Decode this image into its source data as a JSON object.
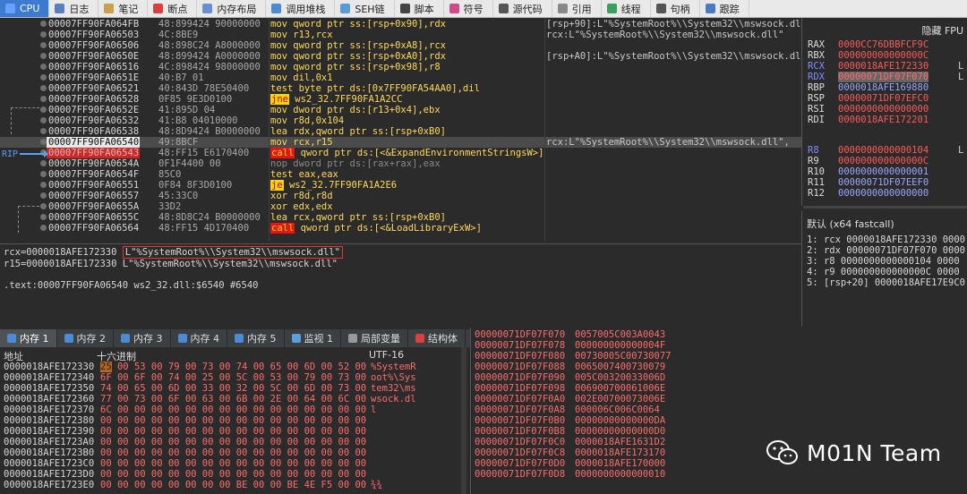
{
  "tabs": [
    {
      "label": "CPU",
      "icon": "cpu-icon",
      "color": "#6aa0ff",
      "active": true
    },
    {
      "label": "日志",
      "icon": "log-icon",
      "color": "#5a7fbf"
    },
    {
      "label": "笔记",
      "icon": "notes-icon",
      "color": "#c9a04b"
    },
    {
      "label": "断点",
      "icon": "breakpoint-icon",
      "color": "#d94040"
    },
    {
      "label": "内存布局",
      "icon": "memory-map-icon",
      "color": "#6a8fd0"
    },
    {
      "label": "调用堆栈",
      "icon": "call-stack-icon",
      "color": "#4b8bd6"
    },
    {
      "label": "SEH链",
      "icon": "seh-icon",
      "color": "#5a9bd8"
    },
    {
      "label": "脚本",
      "icon": "script-icon",
      "color": "#444"
    },
    {
      "label": "符号",
      "icon": "symbol-icon",
      "color": "#d04a8a"
    },
    {
      "label": "源代码",
      "icon": "source-icon",
      "color": "#555"
    },
    {
      "label": "引用",
      "icon": "reference-icon",
      "color": "#888"
    },
    {
      "label": "线程",
      "icon": "thread-icon",
      "color": "#3aa060"
    },
    {
      "label": "句柄",
      "icon": "handle-icon",
      "color": "#555"
    },
    {
      "label": "跟踪",
      "icon": "trace-icon",
      "color": "#4b7bc6"
    }
  ],
  "disasm": [
    {
      "addr": "00007FF90FA064FB",
      "bytes": "48:899424 90000000",
      "instr": "mov qword ptr ss:[rsp+0x90],rdx",
      "comment": "[rsp+90]:L\"%SystemRoot%\\\\System32\\\\mswsock.dll\""
    },
    {
      "addr": "00007FF90FA06503",
      "bytes": "4C:8BE9",
      "instr": "mov r13,rcx",
      "comment": "rcx:L\"%SystemRoot%\\\\System32\\\\mswsock.dll\""
    },
    {
      "addr": "00007FF90FA06506",
      "bytes": "48:898C24 A8000000",
      "instr": "mov qword ptr ss:[rsp+0xA8],rcx",
      "comment": ""
    },
    {
      "addr": "00007FF90FA0650E",
      "bytes": "48:899424 A0000000",
      "instr": "mov qword ptr ss:[rsp+0xA0],rdx",
      "comment": "[rsp+A0]:L\"%SystemRoot%\\\\System32\\\\mswsock.dll\""
    },
    {
      "addr": "00007FF90FA06516",
      "bytes": "4C:898424 98000000",
      "instr": "mov qword ptr ss:[rsp+0x98],r8",
      "comment": ""
    },
    {
      "addr": "00007FF90FA0651E",
      "bytes": "40:B7 01",
      "instr": "mov dil,0x1",
      "comment": ""
    },
    {
      "addr": "00007FF90FA06521",
      "bytes": "40:843D 78E50400",
      "instr": "test byte ptr ds:[0x7FF90FA54AA0],dil",
      "comment": ""
    },
    {
      "addr": "00007FF90FA06528",
      "bytes": "0F85 9E3D0100",
      "kw": "jne",
      "instr": " ws2_32.7FF90FA1A2CC",
      "comment": ""
    },
    {
      "addr": "00007FF90FA0652E",
      "bytes": "41:895D 04",
      "instr": "mov dword ptr ds:[r13+0x4],ebx",
      "comment": ""
    },
    {
      "addr": "00007FF90FA06532",
      "bytes": "41:B8 04010000",
      "instr": "mov r8d,0x104",
      "comment": ""
    },
    {
      "addr": "00007FF90FA06538",
      "bytes": "48:8D9424 B0000000",
      "instr": "lea rdx,qword ptr ss:[rsp+0xB0]",
      "comment": ""
    },
    {
      "addr": "00007FF90FA06540",
      "bytes": "49:8BCF",
      "instr": "mov rcx,r15",
      "comment": "rcx:L\"%SystemRoot%\\\\System32\\\\mswsock.dll\",",
      "state": "current"
    },
    {
      "addr": "00007FF90FA06543",
      "bytes": "48:FF15 E6170400",
      "kw": "call",
      "instr": " qword ptr ds:[<&ExpandEnvironmentStringsW>]",
      "comment": "",
      "state": "rip"
    },
    {
      "addr": "00007FF90FA0654A",
      "bytes": "0F1F4400 00",
      "instr": "nop dword ptr ds:[rax+rax],eax",
      "comment": "",
      "gray": true
    },
    {
      "addr": "00007FF90FA0654F",
      "bytes": "85C0",
      "instr": "test eax,eax",
      "comment": ""
    },
    {
      "addr": "00007FF90FA06551",
      "bytes": "0F84 8F3D0100",
      "kw": "je",
      "instr": " ws2_32.7FF90FA1A2E6",
      "comment": ""
    },
    {
      "addr": "00007FF90FA06557",
      "bytes": "45:33C0",
      "instr": "xor r8d,r8d",
      "comment": ""
    },
    {
      "addr": "00007FF90FA0655A",
      "bytes": "33D2",
      "instr": "xor edx,edx",
      "comment": ""
    },
    {
      "addr": "00007FF90FA0655C",
      "bytes": "48:8D8C24 B0000000",
      "instr": "lea rcx,qword ptr ss:[rsp+0xB0]",
      "comment": ""
    },
    {
      "addr": "00007FF90FA06564",
      "bytes": "48:FF15 4D170400",
      "kw": "call",
      "instr": " qword ptr ds:[<&LoadLibraryExW>]",
      "comment": ""
    }
  ],
  "rip_label": "RIP",
  "info": {
    "line1_prefix": "rcx=0000018AFE172330 ",
    "line1_boxed": "L\"%SystemRoot%\\\\System32\\\\mswsock.dll\"",
    "line2": "r15=0000018AFE172330 L\"%SystemRoot%\\\\System32\\\\mswsock.dll\"",
    "line3": ".text:00007FF90FA06540 ws2_32.dll:$6540 #6540"
  },
  "registers": {
    "header": "隐藏 FPU",
    "rows": [
      {
        "name": "RAX",
        "value": "0000CC76DBBFCF9C",
        "tail": ""
      },
      {
        "name": "RBX",
        "value": "000000000000000C",
        "tail": ""
      },
      {
        "name": "RCX",
        "value": "0000018AFE172330",
        "tail": "L",
        "mod": true
      },
      {
        "name": "RDX",
        "value": "00000071DF07F070",
        "tail": "L",
        "mod": true,
        "sel": true
      },
      {
        "name": "RBP",
        "value": "0000018AFE169880",
        "tail": "",
        "blue": true
      },
      {
        "name": "RSP",
        "value": "00000071DF07EFC0",
        "tail": ""
      },
      {
        "name": "RSI",
        "value": "0000000000000000",
        "tail": ""
      },
      {
        "name": "RDI",
        "value": "0000018AFE172201",
        "tail": ""
      },
      {
        "name": "R8",
        "value": "0000000000000104",
        "tail": "L",
        "mod": true
      },
      {
        "name": "R9",
        "value": "000000000000000C",
        "tail": ""
      },
      {
        "name": "R10",
        "value": "0000000000000001",
        "tail": "",
        "blue": true
      },
      {
        "name": "R11",
        "value": "00000071DF07EEF0",
        "tail": "",
        "blue": true
      },
      {
        "name": "R12",
        "value": "0000000000000000",
        "tail": "",
        "blue": true
      }
    ]
  },
  "callconv": {
    "header": "默认 (x64 fastcall)",
    "lines": [
      "1: rcx 0000018AFE172330 0000",
      "2: rdx 00000071DF07F070 0000",
      "3: r8 0000000000000104 0000",
      "4: r9 000000000000000C 0000",
      "5: [rsp+20] 0000018AFE17E9C0 0"
    ]
  },
  "memtabs": [
    {
      "label": "内存 1",
      "icon": "memory-icon",
      "color": "#4b8bd6",
      "active": true
    },
    {
      "label": "内存 2",
      "icon": "memory-icon",
      "color": "#4b8bd6"
    },
    {
      "label": "内存 3",
      "icon": "memory-icon",
      "color": "#4b8bd6"
    },
    {
      "label": "内存 4",
      "icon": "memory-icon",
      "color": "#4b8bd6"
    },
    {
      "label": "内存 5",
      "icon": "memory-icon",
      "color": "#4b8bd6"
    },
    {
      "label": "监视 1",
      "icon": "watch-icon",
      "color": "#5aa0e0"
    },
    {
      "label": "局部变量",
      "icon": "locals-icon",
      "color": "#999"
    },
    {
      "label": "结构体",
      "icon": "struct-icon",
      "color": "#d94040"
    }
  ],
  "dump": {
    "col_addr": "地址",
    "col_hex": "十六进制",
    "col_text": "UTF-16",
    "rows": [
      {
        "addr": "0000018AFE172330",
        "first": "25",
        "hex": " 00 53 00 79 00 73 00  74 00 65 00 6D 00 52 00",
        "text": "%SystemR"
      },
      {
        "addr": "0000018AFE172340",
        "first": "",
        "hex": "6F 00 6F 00 74 00 25 00  5C 00 53 00 79 00 73 00",
        "text": "oot%\\Sys"
      },
      {
        "addr": "0000018AFE172350",
        "first": "",
        "hex": "74 00 65 00 6D 00 33 00  32 00 5C 00 6D 00 73 00",
        "text": "tem32\\ms"
      },
      {
        "addr": "0000018AFE172360",
        "first": "",
        "hex": "77 00 73 00 6F 00 63 00  6B 00 2E 00 64 00 6C 00",
        "text": "wsock.dl"
      },
      {
        "addr": "0000018AFE172370",
        "first": "",
        "hex": "6C 00 00 00 00 00 00 00  00 00 00 00 00 00 00 00",
        "text": "l"
      },
      {
        "addr": "0000018AFE172380",
        "first": "",
        "hex": "00 00 00 00 00 00 00 00  00 00 00 00 00 00 00 00",
        "text": ""
      },
      {
        "addr": "0000018AFE172390",
        "first": "",
        "hex": "00 00 00 00 00 00 00 00  00 00 00 00 00 00 00 00",
        "text": ""
      },
      {
        "addr": "0000018AFE1723A0",
        "first": "",
        "hex": "00 00 00 00 00 00 00 00  00 00 00 00 00 00 00 00",
        "text": ""
      },
      {
        "addr": "0000018AFE1723B0",
        "first": "",
        "hex": "00 00 00 00 00 00 00 00  00 00 00 00 00 00 00 00",
        "text": ""
      },
      {
        "addr": "0000018AFE1723C0",
        "first": "",
        "hex": "00 00 00 00 00 00 00 00  00 00 00 00 00 00 00 00",
        "text": ""
      },
      {
        "addr": "0000018AFE1723D0",
        "first": "",
        "hex": "00 00 00 00 00 00 00 00  00 00 00 00 00 00 00 00",
        "text": ""
      },
      {
        "addr": "0000018AFE1723E0",
        "first": "",
        "hex": "00 00 00 00 00 00 00 00  BE 00 00 BE 4E F5 00 00",
        "text": "¾¾"
      }
    ]
  },
  "stack": [
    {
      "addr": "00000071DF07F070",
      "value": "0057005C003A0043"
    },
    {
      "addr": "00000071DF07F078",
      "value": "000000000000004F"
    },
    {
      "addr": "00000071DF07F080",
      "value": "00730005C00730077"
    },
    {
      "addr": "00000071DF07F088",
      "value": "0065007400730079"
    },
    {
      "addr": "00000071DF07F090",
      "value": "005C00320033006D"
    },
    {
      "addr": "00000071DF07F098",
      "value": "006900700061006E"
    },
    {
      "addr": "00000071DF07F0A0",
      "value": "002E00700073006E"
    },
    {
      "addr": "00000071DF07F0A8",
      "value": "000006C006C0064"
    },
    {
      "addr": "00000071DF07F0B0",
      "value": "00000000000000DA"
    },
    {
      "addr": "00000071DF07F0B8",
      "value": "00000000000000D0"
    },
    {
      "addr": "00000071DF07F0C0",
      "value": "0000018AFE1631D2"
    },
    {
      "addr": "00000071DF07F0C8",
      "value": "0000018AFE173170"
    },
    {
      "addr": "00000071DF07F0D0",
      "value": "0000018AFE170000"
    },
    {
      "addr": "00000071DF07F0D8",
      "value": "0000000000000010"
    }
  ],
  "watermark": {
    "text": "M01N Team",
    "icon": "wechat-icon"
  }
}
